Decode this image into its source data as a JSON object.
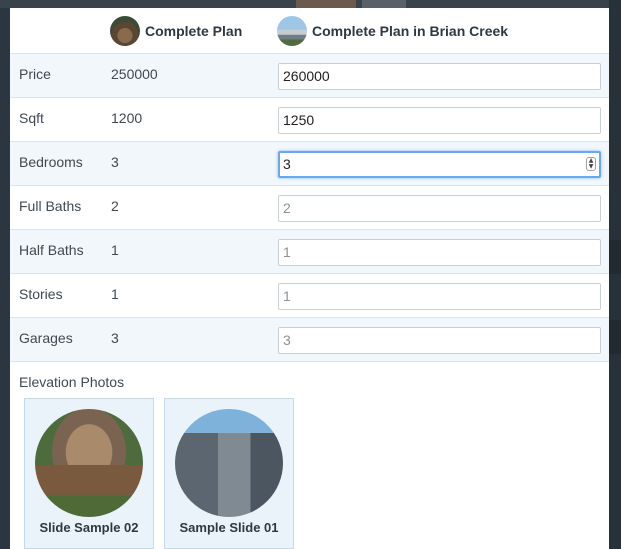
{
  "plans": [
    {
      "title": "Complete Plan",
      "avatar_icon": "house-photo-icon"
    },
    {
      "title": "Complete Plan in Brian Creek",
      "avatar_icon": "house-photo-icon"
    }
  ],
  "rows": [
    {
      "label": "Price",
      "base": "250000",
      "value": "260000",
      "placeholder": ""
    },
    {
      "label": "Sqft",
      "base": "1200",
      "value": "1250",
      "placeholder": ""
    },
    {
      "label": "Bedrooms",
      "base": "3",
      "value": "3",
      "placeholder": ""
    },
    {
      "label": "Full Baths",
      "base": "2",
      "value": "",
      "placeholder": "2"
    },
    {
      "label": "Half Baths",
      "base": "1",
      "value": "",
      "placeholder": "1"
    },
    {
      "label": "Stories",
      "base": "1",
      "value": "",
      "placeholder": "1"
    },
    {
      "label": "Garages",
      "base": "3",
      "value": "",
      "placeholder": "3"
    }
  ],
  "elevation": {
    "title": "Elevation Photos",
    "photos": [
      {
        "caption": "Slide Sample 02"
      },
      {
        "caption": "Sample Slide 01"
      }
    ]
  },
  "colors": {
    "focus": "#6aa8e8",
    "row_alt": "#f1f7fb",
    "card_bg": "#eaf3f9"
  }
}
